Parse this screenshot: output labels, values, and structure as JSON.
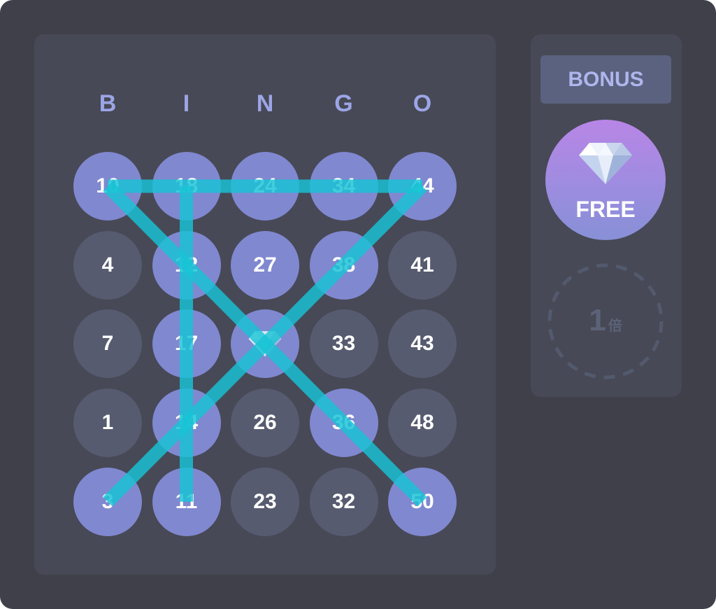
{
  "board": {
    "columns": [
      "B",
      "I",
      "N",
      "G",
      "O"
    ],
    "rows": [
      [
        {
          "n": "10",
          "marked": true
        },
        {
          "n": "18",
          "marked": true
        },
        {
          "n": "24",
          "marked": true
        },
        {
          "n": "34",
          "marked": true
        },
        {
          "n": "44",
          "marked": true
        }
      ],
      [
        {
          "n": "4",
          "marked": false
        },
        {
          "n": "12",
          "marked": true
        },
        {
          "n": "27",
          "marked": true
        },
        {
          "n": "38",
          "marked": true
        },
        {
          "n": "41",
          "marked": false
        }
      ],
      [
        {
          "n": "7",
          "marked": false
        },
        {
          "n": "17",
          "marked": true
        },
        {
          "n": "FREE",
          "marked": true,
          "free": true
        },
        {
          "n": "33",
          "marked": false
        },
        {
          "n": "43",
          "marked": false
        }
      ],
      [
        {
          "n": "1",
          "marked": false
        },
        {
          "n": "14",
          "marked": true
        },
        {
          "n": "26",
          "marked": false
        },
        {
          "n": "36",
          "marked": true
        },
        {
          "n": "48",
          "marked": false
        }
      ],
      [
        {
          "n": "3",
          "marked": true
        },
        {
          "n": "11",
          "marked": true
        },
        {
          "n": "23",
          "marked": false
        },
        {
          "n": "32",
          "marked": false
        },
        {
          "n": "50",
          "marked": true
        }
      ]
    ],
    "winning_lines": [
      {
        "from": [
          0,
          0
        ],
        "to": [
          0,
          4
        ]
      },
      {
        "from": [
          0,
          1
        ],
        "to": [
          4,
          1
        ]
      },
      {
        "from": [
          0,
          0
        ],
        "to": [
          4,
          4
        ]
      },
      {
        "from": [
          0,
          4
        ],
        "to": [
          4,
          0
        ]
      }
    ]
  },
  "sidebar": {
    "bonus_label": "BONUS",
    "free_label": "FREE",
    "multiplier_value": "1",
    "multiplier_unit": "倍"
  },
  "colors": {
    "marked": "#8088d0",
    "unmarked": "#575b70",
    "line": "#17c4d6",
    "letters": "#9ca5e6"
  }
}
